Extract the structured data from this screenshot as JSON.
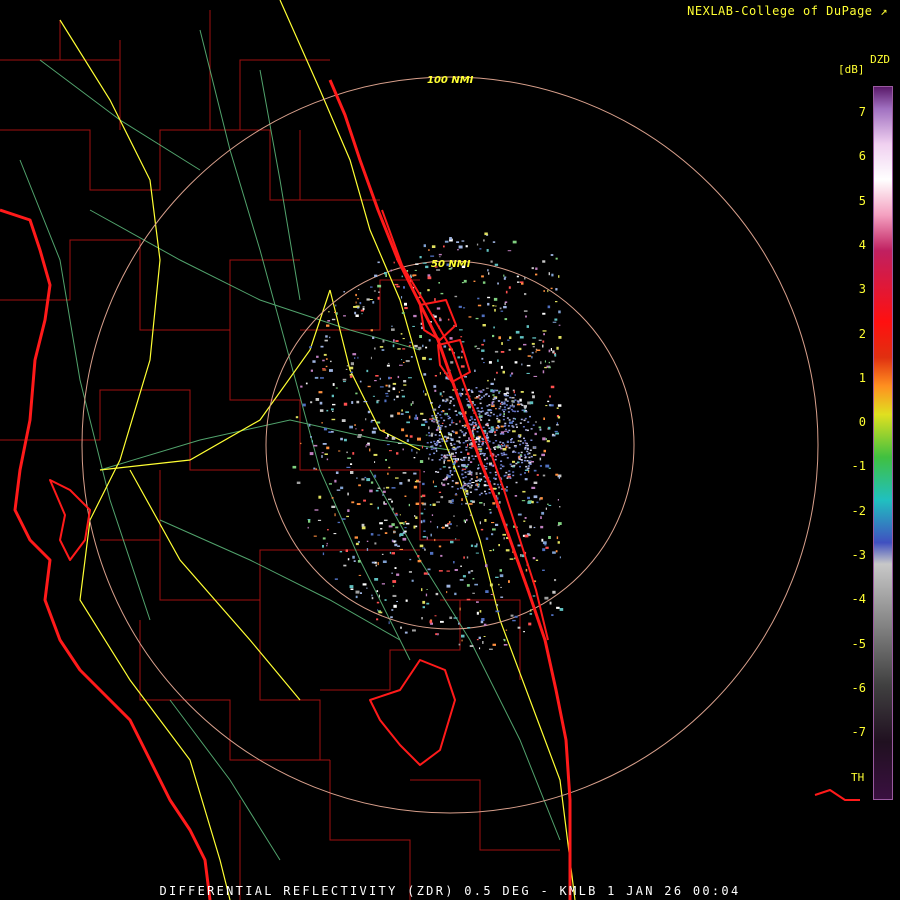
{
  "header": {
    "credit": "NEXLAB-College of DuPage"
  },
  "footer": {
    "product_line": "DIFFERENTIAL REFLECTIVITY (ZDR) 0.5 DEG - KMLB 1 JAN 26 00:04"
  },
  "range_rings": {
    "labels": [
      "100 NMI",
      "50 NMI"
    ],
    "color": "#d9a08c",
    "label_color": "#ffff33"
  },
  "legend": {
    "product": "DZD",
    "unit": "[dB]",
    "ticks": [
      "7",
      "6",
      "5",
      "4",
      "3",
      "2",
      "1",
      "0",
      "-1",
      "-2",
      "-3",
      "-4",
      "-5",
      "-6",
      "-7"
    ],
    "threshold_label": "TH",
    "text_color": "#ffff33"
  },
  "map": {
    "coastline_color": "#ff1a1a",
    "county_color": "#a01010",
    "highway_color": "#ffff33",
    "road_color": "#66cc88",
    "background": "#000000"
  }
}
